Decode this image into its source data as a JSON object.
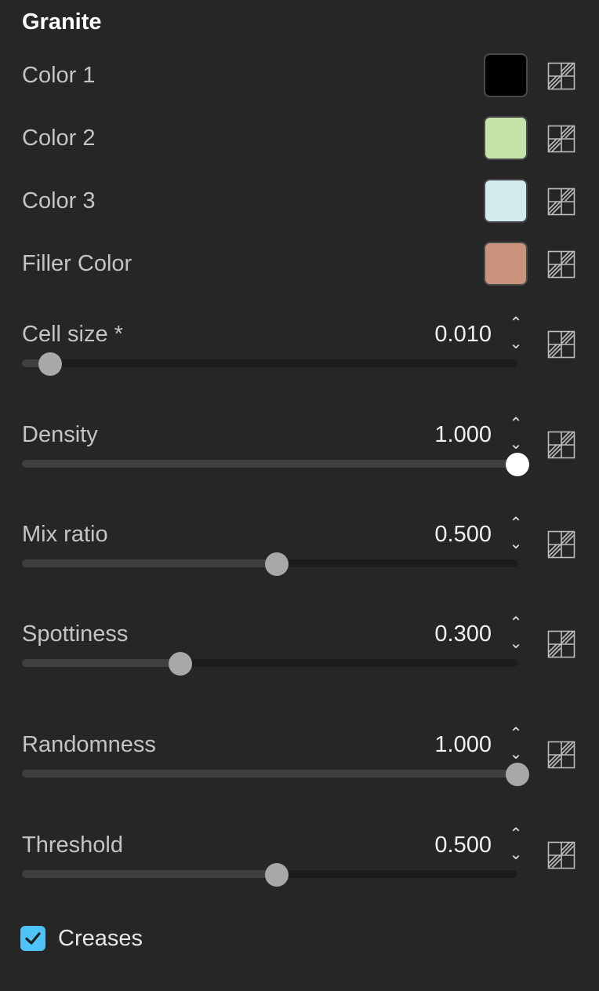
{
  "panel": {
    "title": "Granite"
  },
  "colors": [
    {
      "label": "Color 1",
      "swatch": "#000000",
      "icon": "texture-map-icon"
    },
    {
      "label": "Color 2",
      "swatch": "#c5e5a8",
      "icon": "texture-map-icon"
    },
    {
      "label": "Color 3",
      "swatch": "#d2ebee",
      "icon": "texture-map-icon"
    },
    {
      "label": "Filler Color",
      "swatch": "#c9937d",
      "icon": "texture-map-icon"
    }
  ],
  "sliders": [
    {
      "label": "Cell size *",
      "value": "0.010",
      "fraction": 0.03,
      "up": "⌃",
      "down": "⌄",
      "icon": "texture-map-icon"
    },
    {
      "label": "Density",
      "value": "1.000",
      "fraction": 1.0,
      "up": "⌃",
      "down": "⌄",
      "icon": "texture-map-icon",
      "active": true
    },
    {
      "label": "Mix ratio",
      "value": "0.500",
      "fraction": 0.5,
      "up": "⌃",
      "down": "⌄",
      "icon": "texture-map-icon"
    },
    {
      "label": "Spottiness",
      "value": "0.300",
      "fraction": 0.3,
      "up": "⌃",
      "down": "⌄",
      "icon": "texture-map-icon"
    },
    {
      "label": "Randomness",
      "value": "1.000",
      "fraction": 1.0,
      "up": "⌃",
      "down": "⌄",
      "icon": "texture-map-icon"
    },
    {
      "label": "Threshold",
      "value": "0.500",
      "fraction": 0.5,
      "up": "⌃",
      "down": "⌄",
      "icon": "texture-map-icon"
    }
  ],
  "creases": {
    "label": "Creases",
    "checked": true,
    "accent": "#4fc3f7"
  }
}
